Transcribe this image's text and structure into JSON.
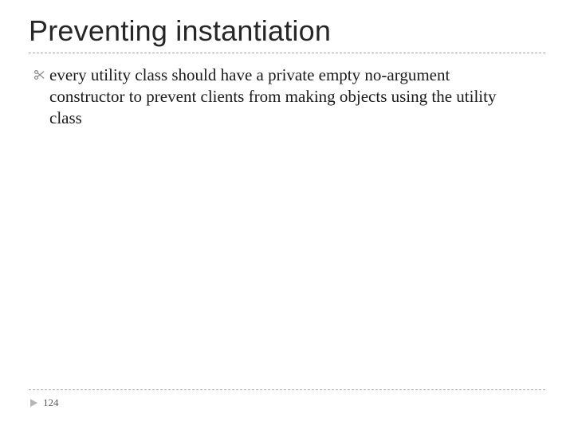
{
  "title": "Preventing instantiation",
  "bullets": [
    "every utility class should have a private empty no-argument constructor to prevent clients from making objects using the utility class"
  ],
  "page_number": "124"
}
